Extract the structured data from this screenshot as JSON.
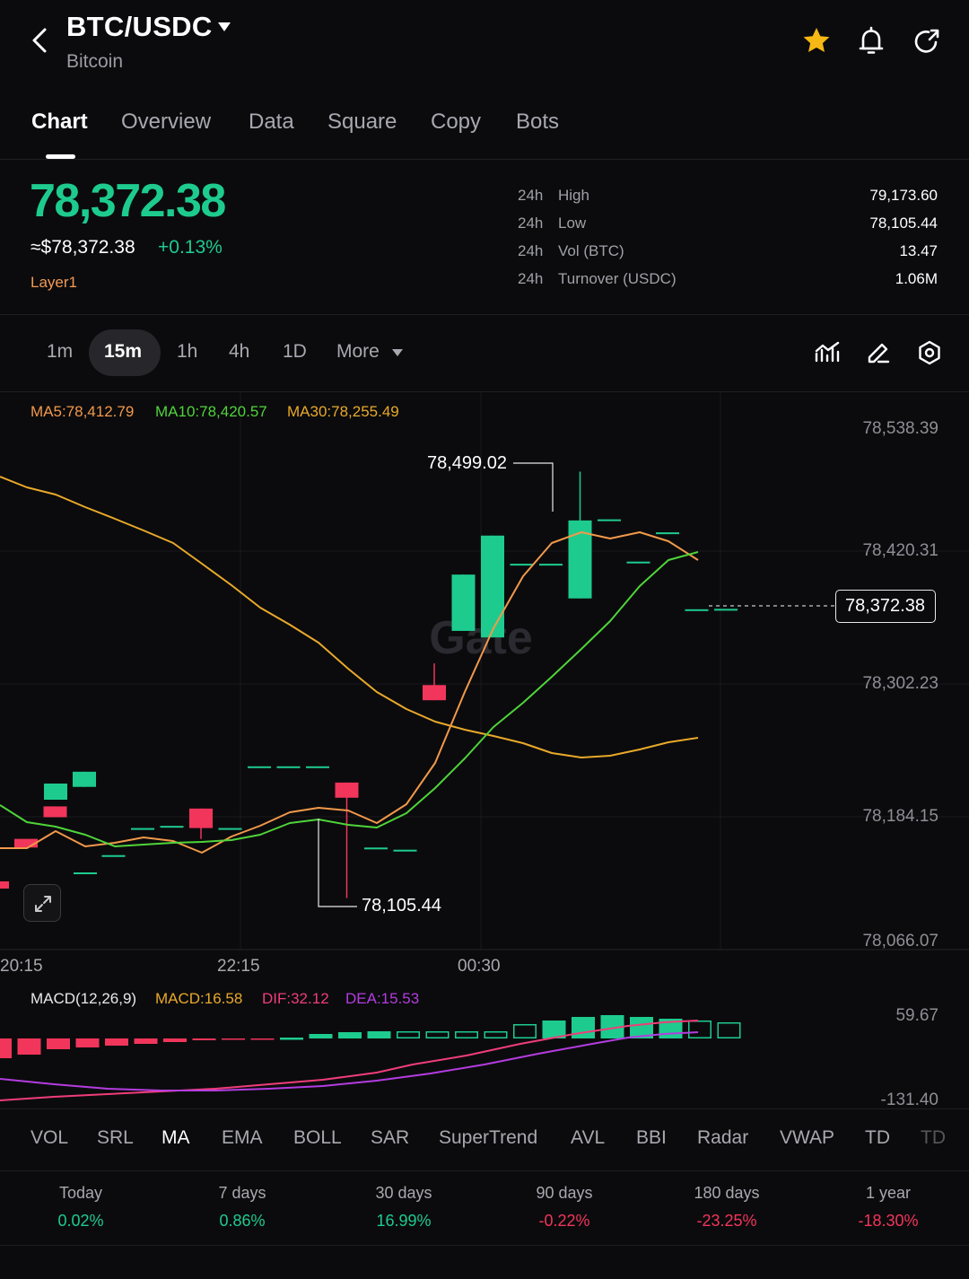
{
  "header": {
    "pair": "BTC/USDC",
    "name": "Bitcoin",
    "icons": [
      "back-icon",
      "chevron-down-icon",
      "star-icon",
      "bell-icon",
      "share-icon"
    ]
  },
  "tabs": [
    "Chart",
    "Overview",
    "Data",
    "Square",
    "Copy",
    "Bots"
  ],
  "ticker": {
    "price": "78,372.38",
    "usd": "≈$78,372.38",
    "change": "+0.13%",
    "tag": "Layer1",
    "stats": [
      {
        "period": "24h",
        "label": "High",
        "value": "79,173.60"
      },
      {
        "period": "24h",
        "label": "Low",
        "value": "78,105.44"
      },
      {
        "period": "24h",
        "label": "Vol (BTC)",
        "value": "13.47"
      },
      {
        "period": "24h",
        "label": "Turnover (USDC)",
        "value": "1.06M"
      }
    ]
  },
  "timeframes": [
    "1m",
    "15m",
    "1h",
    "4h",
    "1D",
    "More"
  ],
  "colors": {
    "up": "#1ecb8e",
    "down": "#f2355b",
    "ma5": "#f2994a",
    "ma10": "#4fd43a",
    "ma30": "#e9a92a",
    "dif": "#f03d7a",
    "dea": "#b43ce0"
  },
  "ma_legend": {
    "ma5": "MA5:78,412.79",
    "ma10": "MA10:78,420.57",
    "ma30": "MA30:78,255.49"
  },
  "chart_data": {
    "type": "candlestick",
    "price_axis": [
      "78,538.39",
      "78,420.31",
      "78,302.23",
      "78,184.15",
      "78,066.07"
    ],
    "time_axis": [
      "20:15",
      "22:15",
      "00:30"
    ],
    "high_label": "78,499.02",
    "low_label": "78,105.44",
    "last_price_label": "78,372.38",
    "watermark": "Gate",
    "ylim": [
      78066.07,
      78538.39
    ],
    "candles": [
      {
        "o": 78160.0,
        "c": 78152.0,
        "h": 78160.0,
        "l": 78152.0
      },
      {
        "o": 78190.0,
        "c": 78180.0,
        "h": 78190.0,
        "l": 78180.0
      },
      {
        "o": 78208.0,
        "c": 78222.0,
        "h": 78222.0,
        "l": 78208.0
      },
      {
        "o": 78145.0,
        "c": 78145.0,
        "h": 78145.0,
        "l": 78145.0
      },
      {
        "o": 78170.0,
        "c": 78170.0,
        "h": 78170.0,
        "l": 78170.0
      },
      {
        "o": 78172.0,
        "c": 78172.0,
        "h": 78172.0,
        "l": 78172.0
      },
      {
        "o": 78188.0,
        "c": 78170.0,
        "h": 78188.0,
        "l": 78160.0
      },
      {
        "o": 78170.0,
        "c": 78170.0,
        "h": 78170.0,
        "l": 78170.0
      },
      {
        "o": 78227.0,
        "c": 78227.0,
        "h": 78227.0,
        "l": 78227.0
      },
      {
        "o": 78227.0,
        "c": 78227.0,
        "h": 78227.0,
        "l": 78227.0
      },
      {
        "o": 78227.0,
        "c": 78227.0,
        "h": 78227.0,
        "l": 78227.0
      },
      {
        "o": 78212.0,
        "c": 78198.0,
        "h": 78212.0,
        "l": 78105.44
      },
      {
        "o": 78152.0,
        "c": 78152.0,
        "h": 78152.0,
        "l": 78152.0
      },
      {
        "o": 78150.0,
        "c": 78150.0,
        "h": 78150.0,
        "l": 78150.0
      },
      {
        "o": 78302.0,
        "c": 78288.0,
        "h": 78322.0,
        "l": 78288.0
      },
      {
        "o": 78352.0,
        "c": 78404.0,
        "h": 78404.0,
        "l": 78352.0
      },
      {
        "o": 78346.0,
        "c": 78440.0,
        "h": 78440.0,
        "l": 78346.0
      },
      {
        "o": 78414.0,
        "c": 78414.0,
        "h": 78414.0,
        "l": 78414.0
      },
      {
        "o": 78414.0,
        "c": 78414.0,
        "h": 78414.0,
        "l": 78414.0
      },
      {
        "o": 78382.0,
        "c": 78454.0,
        "h": 78499.02,
        "l": 78382.0
      },
      {
        "o": 78455.0,
        "c": 78455.0,
        "h": 78455.0,
        "l": 78455.0
      },
      {
        "o": 78416.0,
        "c": 78416.0,
        "h": 78416.0,
        "l": 78416.0
      },
      {
        "o": 78443.0,
        "c": 78443.0,
        "h": 78443.0,
        "l": 78443.0
      },
      {
        "o": 78372.0,
        "c": 78372.0,
        "h": 78372.0,
        "l": 78372.0
      },
      {
        "o": 78372.38,
        "c": 78372.38,
        "h": 78372.38,
        "l": 78372.38
      }
    ],
    "macd": {
      "legend": "MACD(12,26,9)",
      "macd_label": "MACD:16.58",
      "dif_label": "DIF:32.12",
      "dea_label": "DEA:15.53",
      "axis": [
        "59.67",
        "-131.40"
      ],
      "ylim": [
        -131.4,
        59.67
      ]
    }
  },
  "indicators": [
    "VOL",
    "SRL",
    "MA",
    "EMA",
    "BOLL",
    "SAR",
    "SuperTrend",
    "AVL",
    "BBI",
    "Radar",
    "VWAP",
    "TD",
    "TD"
  ],
  "active_indicator": "MA",
  "performance": [
    {
      "label": "Today",
      "value": "0.02%",
      "dir": "up"
    },
    {
      "label": "7 days",
      "value": "0.86%",
      "dir": "up"
    },
    {
      "label": "30 days",
      "value": "16.99%",
      "dir": "up"
    },
    {
      "label": "90 days",
      "value": "-0.22%",
      "dir": "down"
    },
    {
      "label": "180 days",
      "value": "-23.25%",
      "dir": "down"
    },
    {
      "label": "1 year",
      "value": "-18.30%",
      "dir": "down"
    }
  ]
}
